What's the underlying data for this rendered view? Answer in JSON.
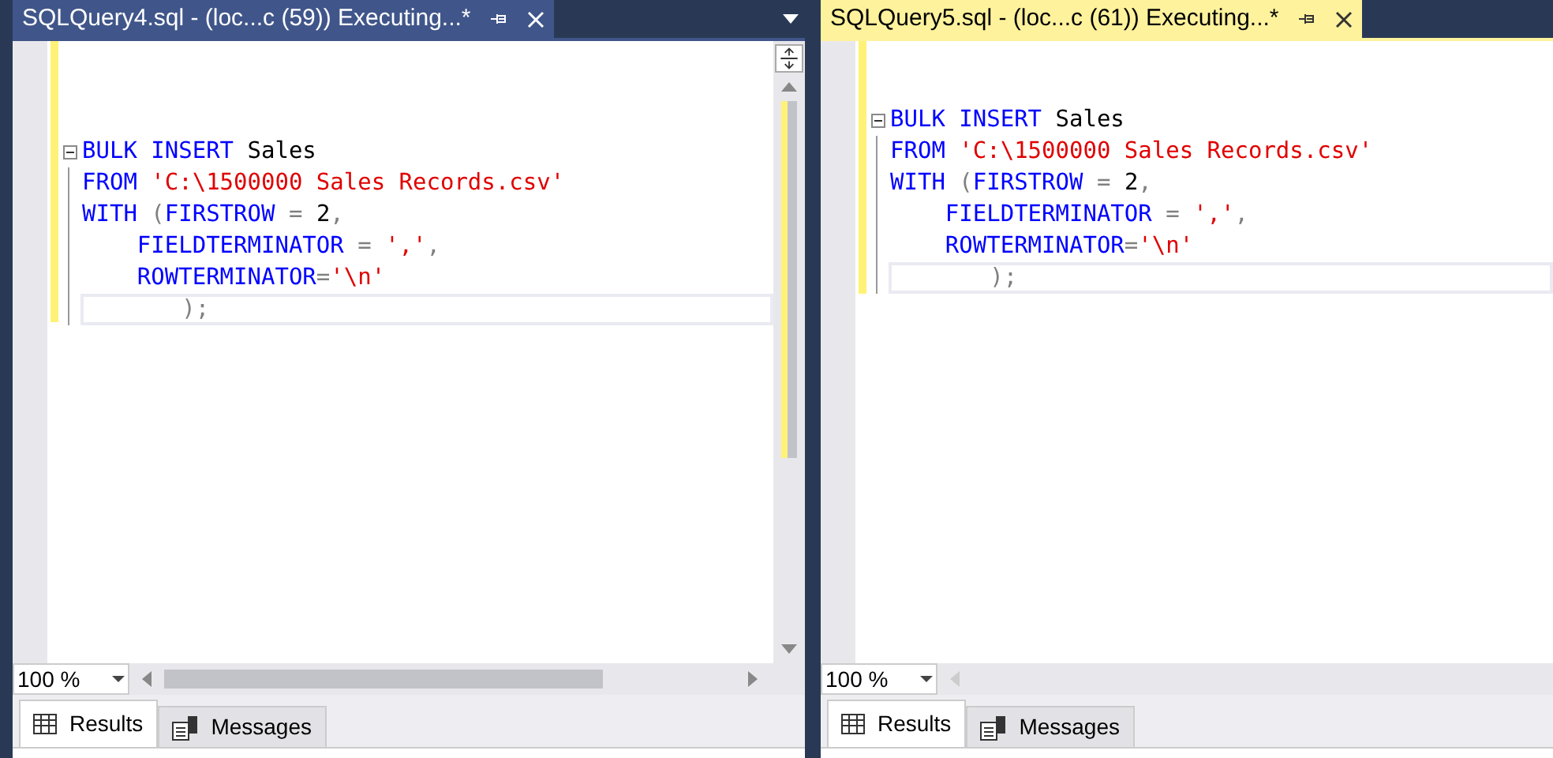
{
  "panes": [
    {
      "tab": {
        "title": "SQLQuery4.sql - (loc...c (59)) Executing...*",
        "selected": false
      },
      "vertical_scrollbar": true,
      "code": [
        {
          "fold": true,
          "current": false,
          "tokens": [
            {
              "kind": "keyword",
              "text": "BULK INSERT"
            },
            {
              "kind": "plain",
              "text": " Sales"
            }
          ]
        },
        {
          "fold": false,
          "current": false,
          "tokens": [
            {
              "kind": "keyword",
              "text": "FROM"
            },
            {
              "kind": "string",
              "text": " 'C:\\1500000 Sales Records.csv'"
            }
          ]
        },
        {
          "fold": false,
          "current": false,
          "tokens": [
            {
              "kind": "keyword",
              "text": "WITH"
            },
            {
              "kind": "operator",
              "text": " ("
            },
            {
              "kind": "keyword",
              "text": "FIRSTROW"
            },
            {
              "kind": "operator",
              "text": " = "
            },
            {
              "kind": "plain",
              "text": "2"
            },
            {
              "kind": "operator",
              "text": ","
            }
          ]
        },
        {
          "fold": false,
          "current": false,
          "tokens": [
            {
              "kind": "keyword",
              "text": "    FIELDTERMINATOR"
            },
            {
              "kind": "operator",
              "text": " = "
            },
            {
              "kind": "string",
              "text": "','"
            },
            {
              "kind": "operator",
              "text": ","
            }
          ]
        },
        {
          "fold": false,
          "current": false,
          "tokens": [
            {
              "kind": "keyword",
              "text": "    ROWTERMINATOR"
            },
            {
              "kind": "operator",
              "text": "="
            },
            {
              "kind": "string",
              "text": "'\\n'"
            }
          ]
        },
        {
          "fold": false,
          "current": true,
          "tokens": [
            {
              "kind": "operator",
              "text": "       );"
            }
          ]
        }
      ],
      "zoom": "100 %",
      "result_tabs": [
        {
          "label": "Results",
          "selected": true
        },
        {
          "label": "Messages",
          "selected": false
        }
      ]
    },
    {
      "tab": {
        "title": "SQLQuery5.sql - (loc...c (61)) Executing...*",
        "selected": true
      },
      "vertical_scrollbar": false,
      "code": [
        {
          "fold": true,
          "current": false,
          "tokens": [
            {
              "kind": "keyword",
              "text": "BULK INSERT"
            },
            {
              "kind": "plain",
              "text": " Sales"
            }
          ]
        },
        {
          "fold": false,
          "current": false,
          "tokens": [
            {
              "kind": "keyword",
              "text": "FROM"
            },
            {
              "kind": "string",
              "text": " 'C:\\1500000 Sales Records.csv'"
            }
          ]
        },
        {
          "fold": false,
          "current": false,
          "tokens": [
            {
              "kind": "keyword",
              "text": "WITH"
            },
            {
              "kind": "operator",
              "text": " ("
            },
            {
              "kind": "keyword",
              "text": "FIRSTROW"
            },
            {
              "kind": "operator",
              "text": " = "
            },
            {
              "kind": "plain",
              "text": "2"
            },
            {
              "kind": "operator",
              "text": ","
            }
          ]
        },
        {
          "fold": false,
          "current": false,
          "tokens": [
            {
              "kind": "keyword",
              "text": "    FIELDTERMINATOR"
            },
            {
              "kind": "operator",
              "text": " = "
            },
            {
              "kind": "string",
              "text": "','"
            },
            {
              "kind": "operator",
              "text": ","
            }
          ]
        },
        {
          "fold": false,
          "current": false,
          "tokens": [
            {
              "kind": "keyword",
              "text": "    ROWTERMINATOR"
            },
            {
              "kind": "operator",
              "text": "="
            },
            {
              "kind": "string",
              "text": "'\\n'"
            }
          ]
        },
        {
          "fold": false,
          "current": true,
          "tokens": [
            {
              "kind": "operator",
              "text": "       );"
            }
          ]
        }
      ],
      "zoom": "100 %",
      "result_tabs": [
        {
          "label": "Results",
          "selected": true
        },
        {
          "label": "Messages",
          "selected": false
        }
      ]
    }
  ]
}
